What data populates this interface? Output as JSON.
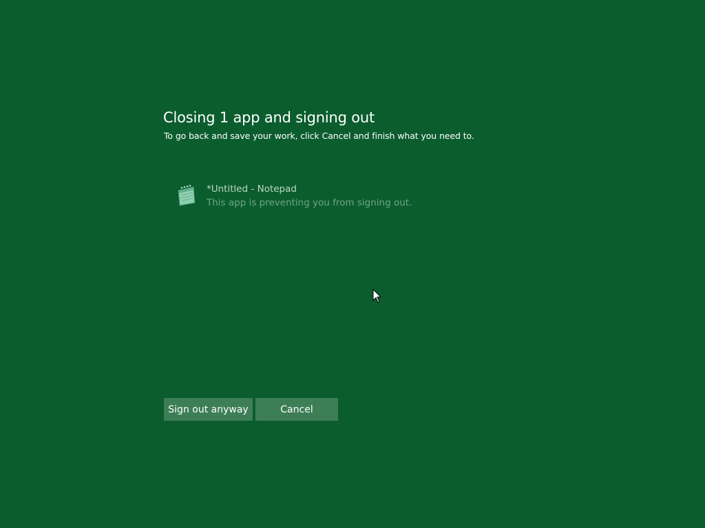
{
  "dialog": {
    "title": "Closing 1 app and signing out",
    "subtitle": "To go back and save your work, click Cancel and finish what you need to."
  },
  "apps": [
    {
      "name": "*Untitled - Notepad",
      "status": "This app is preventing you from signing out.",
      "icon": "notepad-icon"
    }
  ],
  "buttons": {
    "sign_out_label": "Sign out anyway",
    "cancel_label": "Cancel"
  },
  "colors": {
    "background": "#0c5d2e",
    "button": "#3d7e57",
    "app_name": "#b9d8c4",
    "app_status": "#6fa585"
  },
  "cursor": {
    "icon": "mouse-pointer-icon"
  }
}
